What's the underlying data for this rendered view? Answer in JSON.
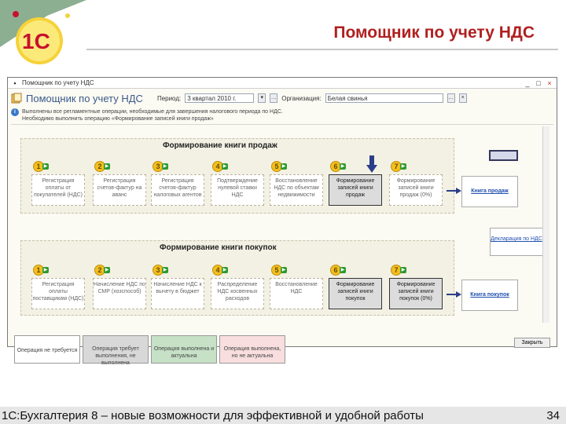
{
  "slide": {
    "title": "Помощник по учету НДС",
    "footer_text": "1С:Бухгалтерия 8 – новые возможности для эффективной и удобной работы",
    "page_number": "34"
  },
  "window": {
    "title": "Помощник по учету НДС",
    "header_title": "Помощник по учету НДС",
    "period_label": "Период:",
    "period_value": "3 квартал 2010 г.",
    "org_label": "Организация:",
    "org_value": "Белая свинья",
    "info_line1": "Выполнены все регламентные операции, необходимые для завершения налогового периода по НДС.",
    "info_line2": "Необходимо выполнить операцию «Формирование записей книги продаж»"
  },
  "sales": {
    "title": "Формирование книги продаж",
    "steps": [
      {
        "num": "1",
        "label": "Регистрация оплаты от покупателей (НДС)"
      },
      {
        "num": "2",
        "label": "Регистрация счетов-фактур на аванс"
      },
      {
        "num": "3",
        "label": "Регистрация счетов-фактур налоговых агентов"
      },
      {
        "num": "4",
        "label": "Подтверждение нулевой ставки НДС"
      },
      {
        "num": "5",
        "label": "Восстановление НДС по объектам недвижимости"
      },
      {
        "num": "6",
        "label": "Формирование записей книги продаж"
      },
      {
        "num": "7",
        "label": "Формирование записей книги продаж (0%)"
      }
    ],
    "output": "Книга продаж"
  },
  "purchases": {
    "title": "Формирование книги покупок",
    "steps": [
      {
        "num": "1",
        "label": "Регистрация оплаты поставщикам (НДС)"
      },
      {
        "num": "2",
        "label": "Начисление НДС по СМР (хозспособ)"
      },
      {
        "num": "3",
        "label": "Начисление НДС к вычету в бюджет"
      },
      {
        "num": "4",
        "label": "Распределение НДС косвенных расходов"
      },
      {
        "num": "5",
        "label": "Восстановление НДС"
      },
      {
        "num": "6",
        "label": "Формирование записей книги покупок"
      },
      {
        "num": "7",
        "label": "Формирование записей книги покупок (0%)"
      }
    ],
    "output": "Книга покупок"
  },
  "declaration": "Декларация по НДС",
  "legend": [
    {
      "label": "Операция не требуется"
    },
    {
      "label": "Операция требует выполнения, не выполнена"
    },
    {
      "label": "Операция выполнена и актуальна"
    },
    {
      "label": "Операция выполнена, но не актуальна"
    }
  ],
  "close_label": "Закрыть",
  "colors": {
    "title_red": "#b01f1f",
    "arrow_blue": "#2a3f8a",
    "step_gold": "#f2bf1f"
  }
}
